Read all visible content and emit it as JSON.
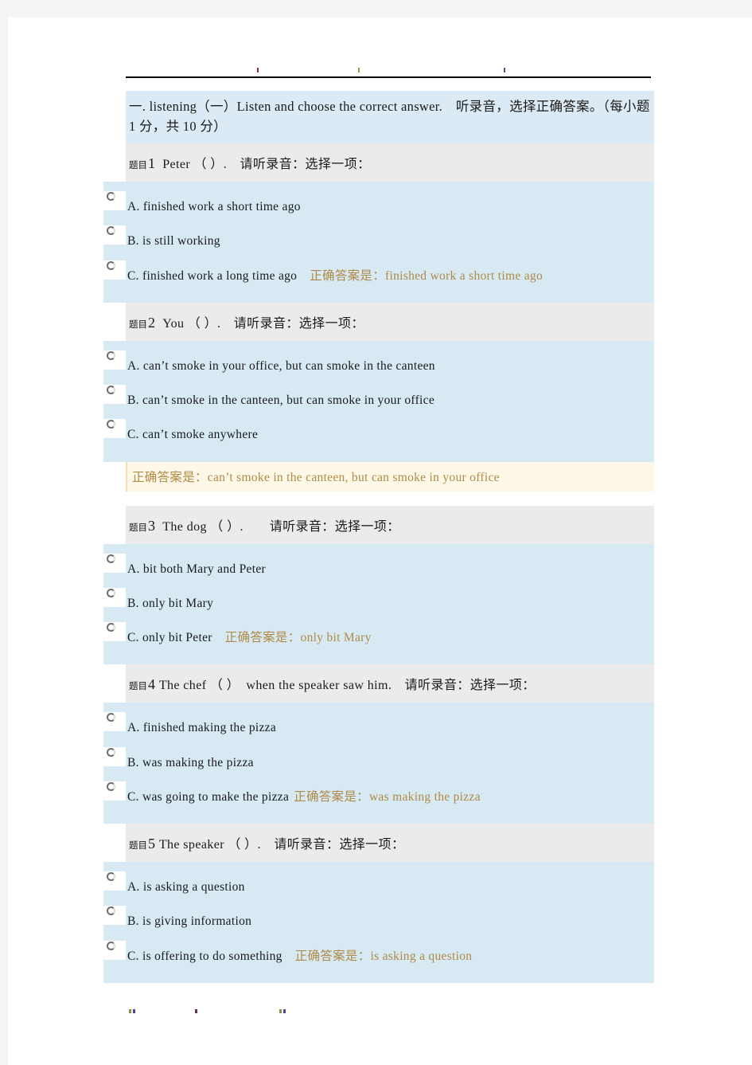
{
  "document": {
    "section_title": "一. listening（一）Listen and choose the correct answer.　听录音，选择正确答案。（每小题 1 分，共 10 分）"
  },
  "questions": [
    {
      "label": "题目",
      "number": "1",
      "stem": "Peter （ ）.　请听录音：选择一项：",
      "options": [
        {
          "text": "A. finished work a short time ago",
          "answer_note": ""
        },
        {
          "text": "B. is still working",
          "answer_note": ""
        },
        {
          "text": "C. finished work a long time ago",
          "answer_note": "正确答案是：finished work a short time ago"
        }
      ],
      "answer_row": ""
    },
    {
      "label": "题目",
      "number": "2",
      "stem": "You （ ）.　请听录音：选择一项：",
      "options": [
        {
          "text": "A. can’t smoke in your office, but can smoke in the canteen",
          "answer_note": ""
        },
        {
          "text": "B. can’t smoke in the canteen, but can smoke in your office",
          "answer_note": ""
        },
        {
          "text": "C. can’t smoke anywhere",
          "answer_note": ""
        }
      ],
      "answer_row": "正确答案是：can’t smoke in the canteen, but can smoke in your office"
    },
    {
      "label": "题目",
      "number": "3",
      "stem": "The dog （ ）.　　请听录音：选择一项：",
      "options": [
        {
          "text": "A. bit both Mary and Peter",
          "answer_note": ""
        },
        {
          "text": "B. only bit Mary",
          "answer_note": ""
        },
        {
          "text": "C. only bit Peter",
          "answer_note": "正确答案是：only bit Mary"
        }
      ],
      "answer_row": ""
    },
    {
      "label": "题目",
      "number": "4",
      "stem": "The chef （ ）　when the speaker saw him.　请听录音：选择一项：",
      "options": [
        {
          "text": "A. finished making the pizza",
          "answer_note": ""
        },
        {
          "text": "B. was making the pizza",
          "answer_note": ""
        },
        {
          "text": "C. was going to make the pizza",
          "answer_note": "正确答案是：was making the pizza"
        }
      ],
      "answer_row": ""
    },
    {
      "label": "题目",
      "number": "5",
      "stem": "The speaker （ ）.　请听录音：选择一项：",
      "options": [
        {
          "text": "A. is asking a question",
          "answer_note": ""
        },
        {
          "text": "B. is giving information",
          "answer_note": ""
        },
        {
          "text": "C. is offering to do something",
          "answer_note": "正确答案是：is asking a question"
        }
      ],
      "answer_row": ""
    }
  ],
  "colors": {
    "page_background": "#f4f4f4",
    "paper": "#ffffff",
    "title_background": "#dbeaf4",
    "question_header_background": "#ebebeb",
    "options_background": "#d7e9f3",
    "answer_row_background": "#fdf8e8",
    "answer_text": "#b08a46",
    "body_text": "#1a1a1a"
  }
}
